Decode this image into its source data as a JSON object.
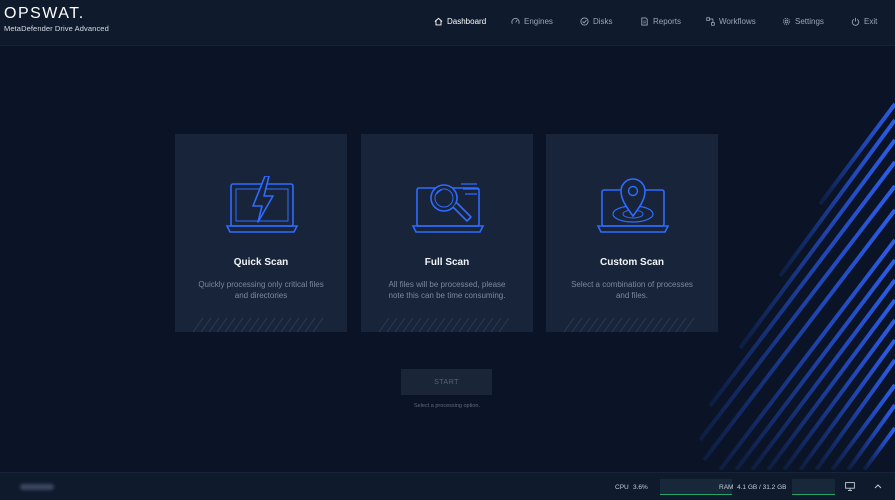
{
  "brand": {
    "logo": "OPSWAT.",
    "product": "MetaDefender Drive Advanced"
  },
  "nav": [
    {
      "label": "Dashboard",
      "icon": "home-icon",
      "active": true
    },
    {
      "label": "Engines",
      "icon": "gauge-icon",
      "active": false
    },
    {
      "label": "Disks",
      "icon": "check-shield-icon",
      "active": false
    },
    {
      "label": "Reports",
      "icon": "document-icon",
      "active": false
    },
    {
      "label": "Workflows",
      "icon": "workflow-icon",
      "active": false
    },
    {
      "label": "Settings",
      "icon": "gear-icon",
      "active": false
    },
    {
      "label": "Exit",
      "icon": "power-icon",
      "active": false
    }
  ],
  "cards": [
    {
      "title": "Quick Scan",
      "desc1": "Quickly processing only critical files",
      "desc2": "and directories",
      "icon": "laptop-lightning-icon"
    },
    {
      "title": "Full Scan",
      "desc1": "All files will be processed, please",
      "desc2": "note this can be time consuming.",
      "icon": "laptop-magnifier-icon"
    },
    {
      "title": "Custom Scan",
      "desc1": "Select a combination of processes",
      "desc2": "and files.",
      "icon": "laptop-pin-icon"
    }
  ],
  "start": {
    "label": "START",
    "hint": "Select a processing option."
  },
  "footer": {
    "cpu_label": "CPU",
    "cpu_value": "3.6%",
    "ram_label": "RAM",
    "ram_value": "4.1 GB / 31.2 GB",
    "icons": [
      "monitor-icon",
      "chevron-up-icon"
    ]
  },
  "colors": {
    "background": "#0b1426",
    "card": "#18243a",
    "accent_blue": "#2f6bff",
    "active_nav": "#ffffff"
  }
}
